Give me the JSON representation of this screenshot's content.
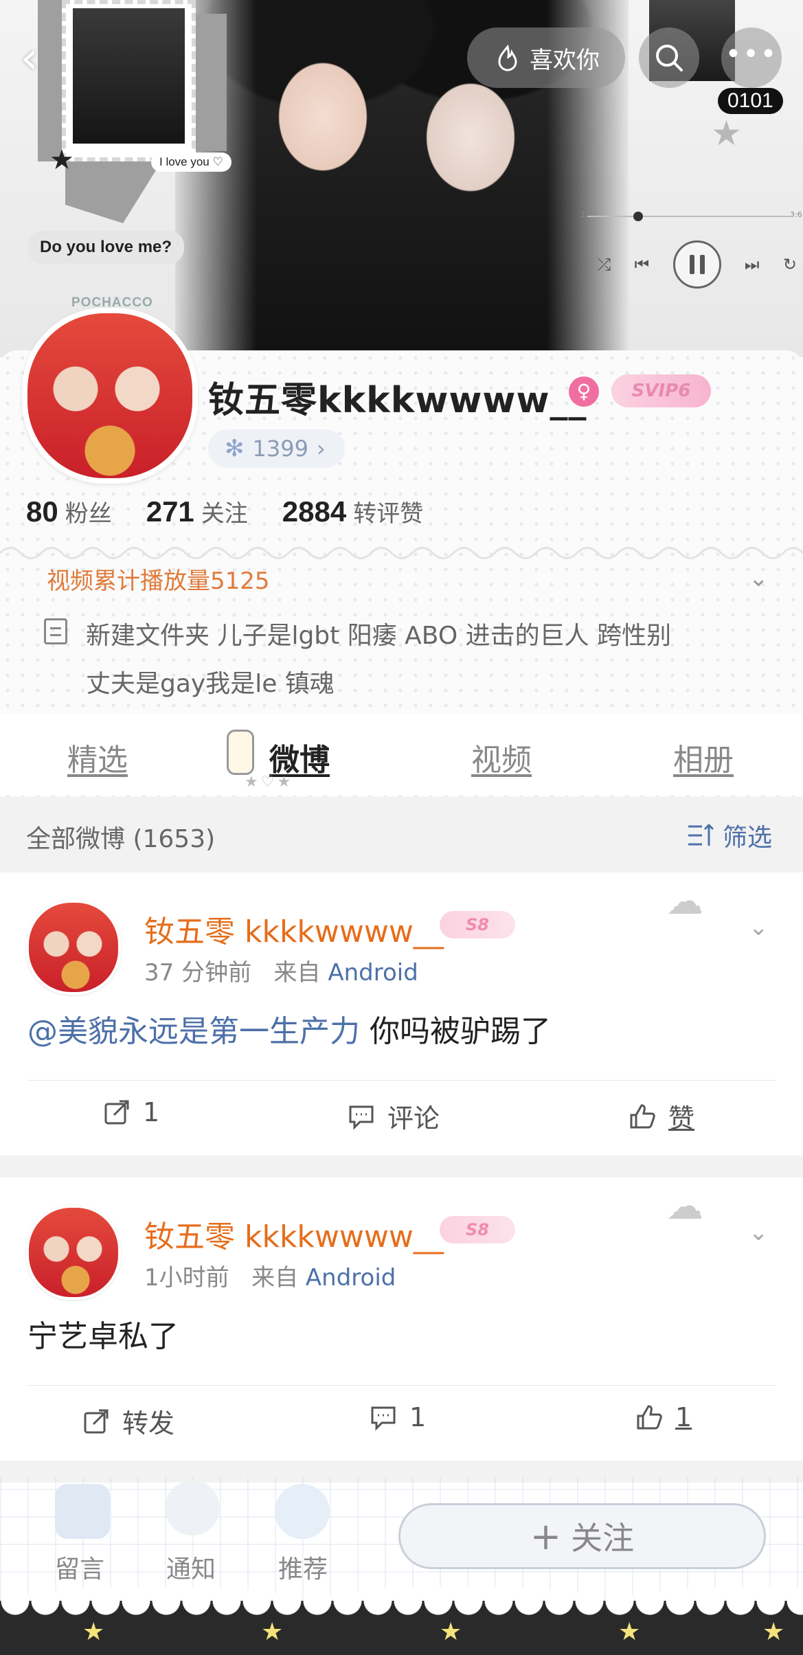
{
  "cover": {
    "bubble_love": "Do you love me?",
    "bubble_iloveyou": "I love you ♡",
    "like_label": "喜欢你",
    "counter": "0101",
    "player": {
      "elapsed": "1:32",
      "total": "3:6"
    }
  },
  "profile": {
    "sticker_text": "POCHACCO",
    "username": "钕五零kkkkwwww__",
    "svip": "SVIP6",
    "level": "1399",
    "stats": [
      {
        "num": "80",
        "label": "粉丝"
      },
      {
        "num": "271",
        "label": "关注"
      },
      {
        "num": "2884",
        "label": "转评赞"
      }
    ],
    "play_count": "视频累计播放量5125",
    "bio_line1": "新建文件夹 儿子是lgbt 阳痿 ABO 进击的巨人 跨性别",
    "bio_line2": "丈夫是gay我是le 镇魂"
  },
  "tabs": [
    "精选",
    "微博",
    "视频",
    "相册"
  ],
  "filter": {
    "title": "全部微博 (1653)",
    "button": "筛选"
  },
  "posts": [
    {
      "name": "钕五零 kkkkwwww__",
      "badge": "S8",
      "time": "37 分钟前",
      "from_prefix": "来自",
      "source": "Android",
      "mention": "@美貌永远是第一生产力",
      "text": " 你吗被驴踢了",
      "repost": "1",
      "comment": "评论",
      "like": "赞"
    },
    {
      "name": "钕五零 kkkkwwww__",
      "badge": "S8",
      "time": "1小时前",
      "from_prefix": "来自",
      "source": "Android",
      "mention": "",
      "text": "宁艺卓私了",
      "repost": "转发",
      "comment": "1",
      "like": "1"
    }
  ],
  "bottom_bar": {
    "items": [
      "留言",
      "通知",
      "推荐"
    ],
    "follow": "关注"
  },
  "colors": {
    "accent_orange": "#e66d1b",
    "link_blue": "#4d70a8"
  }
}
